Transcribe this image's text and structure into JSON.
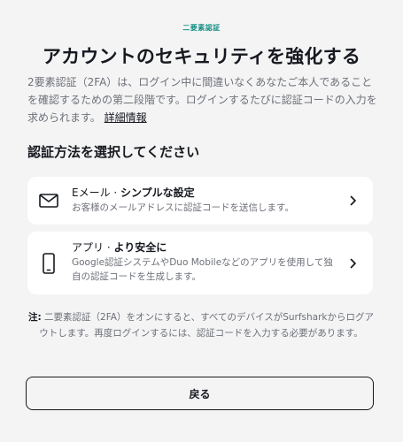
{
  "eyebrow": "二要素認証",
  "title": "アカウントのセキュリティを強化する",
  "intro": {
    "text": "2要素認証（2FA）は、ログイン中に間違いなくあなたご本人であることを確認するための第二段階です。ログインするたびに認証コードの入力を求められます。",
    "link_label": "詳細情報"
  },
  "section_heading": "認証方法を選択してください",
  "options": [
    {
      "icon": "mail-icon",
      "title_prefix": "Eメール · ",
      "title_bold": "シンプルな設定",
      "description": "お客様のメールアドレスに認証コードを送信します。"
    },
    {
      "icon": "phone-icon",
      "title_prefix": "アプリ · ",
      "title_bold": "より安全に",
      "description": "Google認証システムやDuo Mobileなどのアプリを使用して独自の認証コードを生成します。"
    }
  ],
  "note": {
    "label": "注:",
    "text": " 二要素認証（2FA）をオンにすると、すべてのデバイスがSurfsharkからログアウトします。再度ログインするには、認証コードを入力する必要があります。"
  },
  "back_button_label": "戻る",
  "colors": {
    "accent": "#148f86",
    "background": "#f4f4f4",
    "card": "#ffffff",
    "text_primary": "#16191f",
    "text_secondary": "#6d7079"
  }
}
